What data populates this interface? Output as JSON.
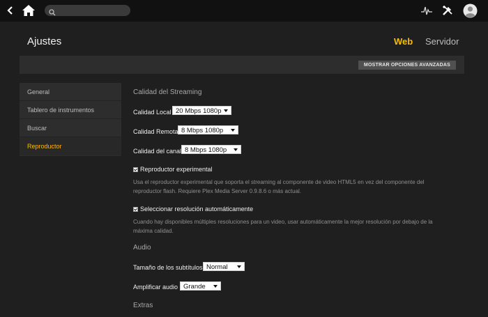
{
  "topbar": {
    "search_placeholder": "",
    "icons": [
      "back-arrow-icon",
      "home-icon",
      "search-icon",
      "activity-icon",
      "tools-icon",
      "avatar-icon"
    ]
  },
  "header": {
    "title": "Ajustes",
    "tabs": [
      {
        "label": "Web",
        "active": true
      },
      {
        "label": "Servidor",
        "active": false
      }
    ],
    "advanced_button": "MOSTRAR OPCIONES AVANZADAS"
  },
  "sidebar": {
    "items": [
      {
        "label": "General",
        "active": false
      },
      {
        "label": "Tablero de instrumentos",
        "active": false
      },
      {
        "label": "Buscar",
        "active": false
      },
      {
        "label": "Reproductor",
        "active": true
      }
    ]
  },
  "streaming": {
    "title": "Calidad del Streaming",
    "local": {
      "label": "Calidad Local",
      "value": "20 Mbps 1080p"
    },
    "remote": {
      "label": "Calidad Remota",
      "value": "8 Mbps 1080p"
    },
    "channel": {
      "label": "Calidad del canal",
      "value": "8 Mbps 1080p"
    },
    "experimental": {
      "label": "Reproductor experimental",
      "checked": true,
      "help": "Usa el reproductor experimental que soporta el streaming al componente de video HTML5 en vez del componente del reproductor flash. Requiere Plex Media Server 0.9.8.6 o más actual."
    },
    "auto_resolution": {
      "label": "Seleccionar resolución automáticamente",
      "checked": true,
      "help": "Cuando hay disponibles múltiples resoluciones para un video, usar automáticamente la mejor resolución por debajo de la máxima calidad."
    }
  },
  "audio": {
    "title": "Audio",
    "subtitle_size": {
      "label": "Tamaño de los subtítulos",
      "value": "Normal"
    },
    "boost": {
      "label": "Amplificar audio",
      "value": "Grande"
    }
  },
  "extras": {
    "title": "Extras"
  },
  "colors": {
    "accent": "#f9be03",
    "background": "#1f1f1f",
    "panel": "#2d2d2d",
    "topbar": "#111111"
  }
}
